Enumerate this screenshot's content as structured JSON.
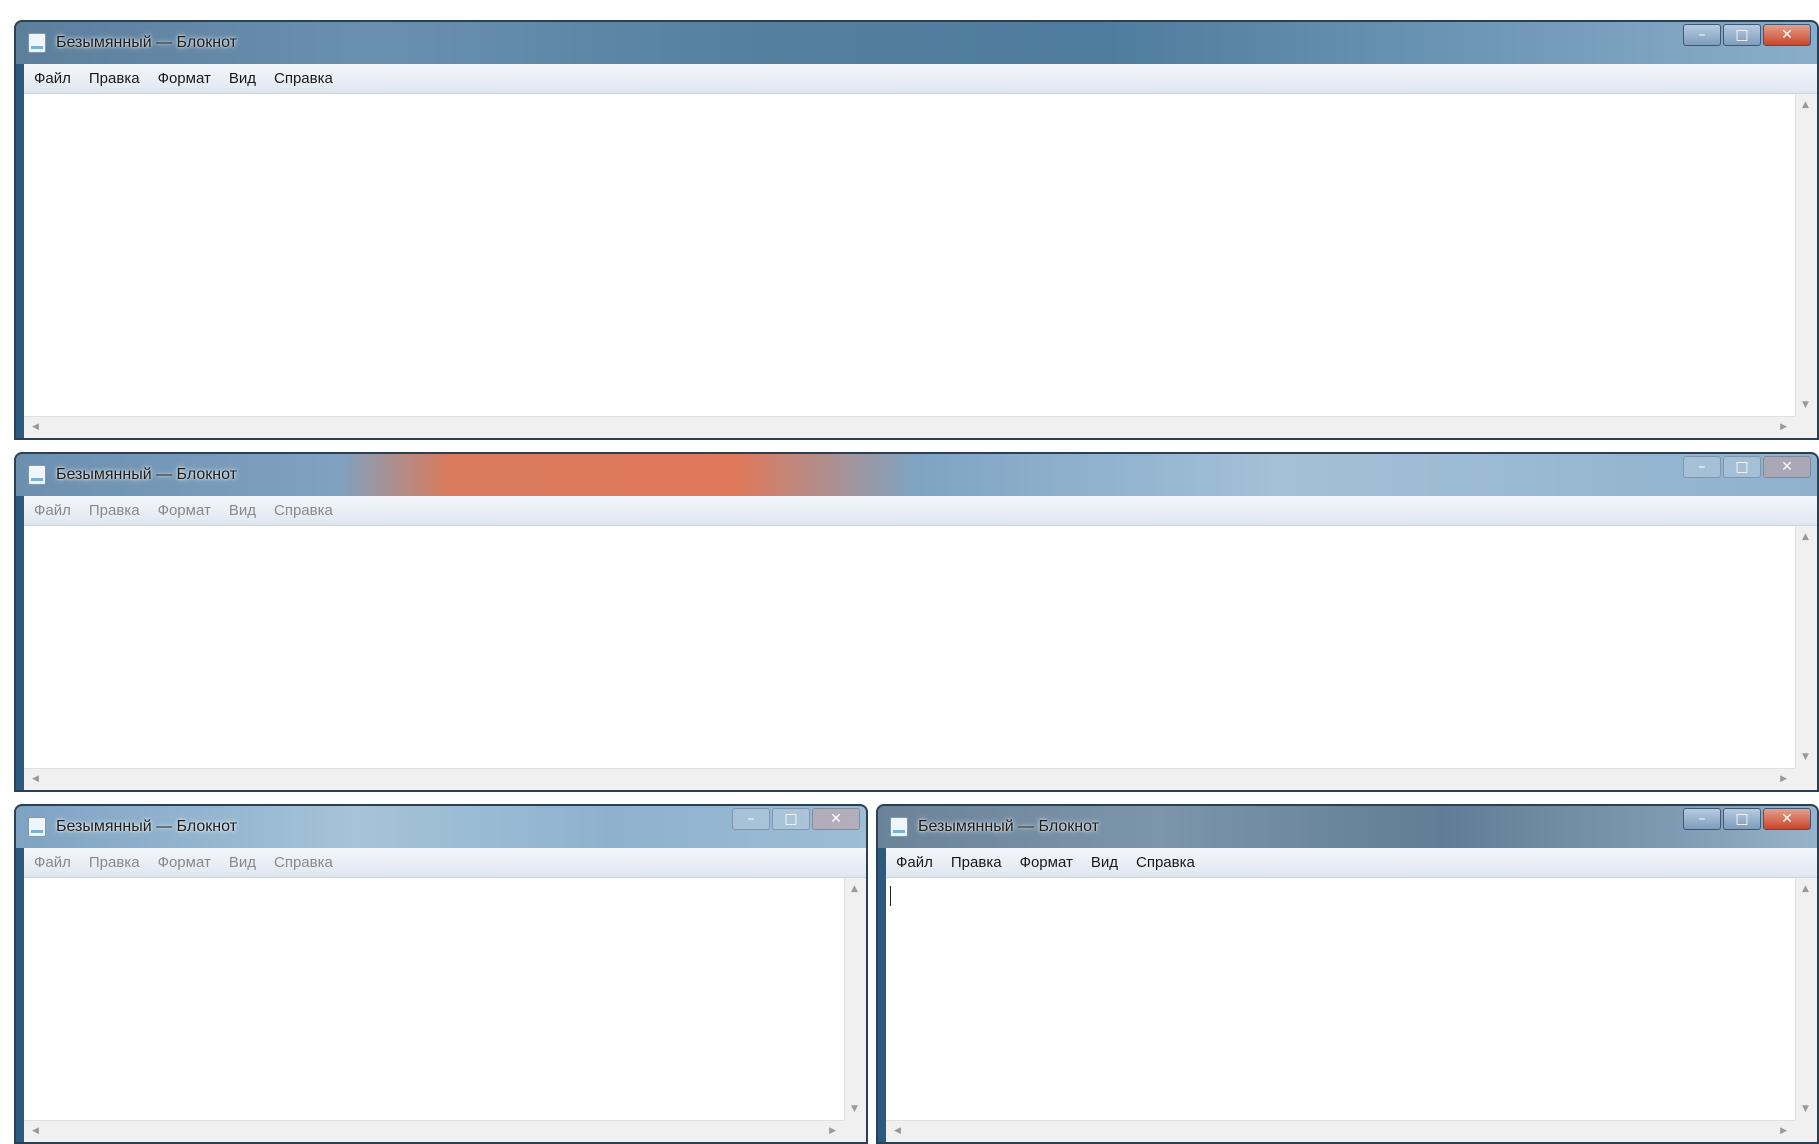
{
  "windows": [
    {
      "title": "Безымянный — Блокнот",
      "menu": [
        "Файл",
        "Правка",
        "Формат",
        "Вид",
        "Справка"
      ],
      "state": "active",
      "controls": {
        "minimize": "–",
        "maximize": "□",
        "close": "✕"
      }
    },
    {
      "title": "Безымянный — Блокнот",
      "menu": [
        "Файл",
        "Правка",
        "Формат",
        "Вид",
        "Справка"
      ],
      "state": "inactive",
      "controls": {
        "minimize": "–",
        "maximize": "□",
        "close": "✕"
      }
    },
    {
      "title": "Безымянный — Блокнот",
      "menu": [
        "Файл",
        "Правка",
        "Формат",
        "Вид",
        "Справка"
      ],
      "state": "inactive",
      "controls": {
        "minimize": "–",
        "maximize": "□",
        "close": "✕"
      }
    },
    {
      "title": "Безымянный — Блокнот",
      "menu": [
        "Файл",
        "Правка",
        "Формат",
        "Вид",
        "Справка"
      ],
      "state": "active",
      "controls": {
        "minimize": "–",
        "maximize": "□",
        "close": "✕"
      }
    }
  ],
  "icons": {
    "scroll_up": "▲",
    "scroll_down": "▼",
    "scroll_left": "◀",
    "scroll_right": "▶"
  }
}
